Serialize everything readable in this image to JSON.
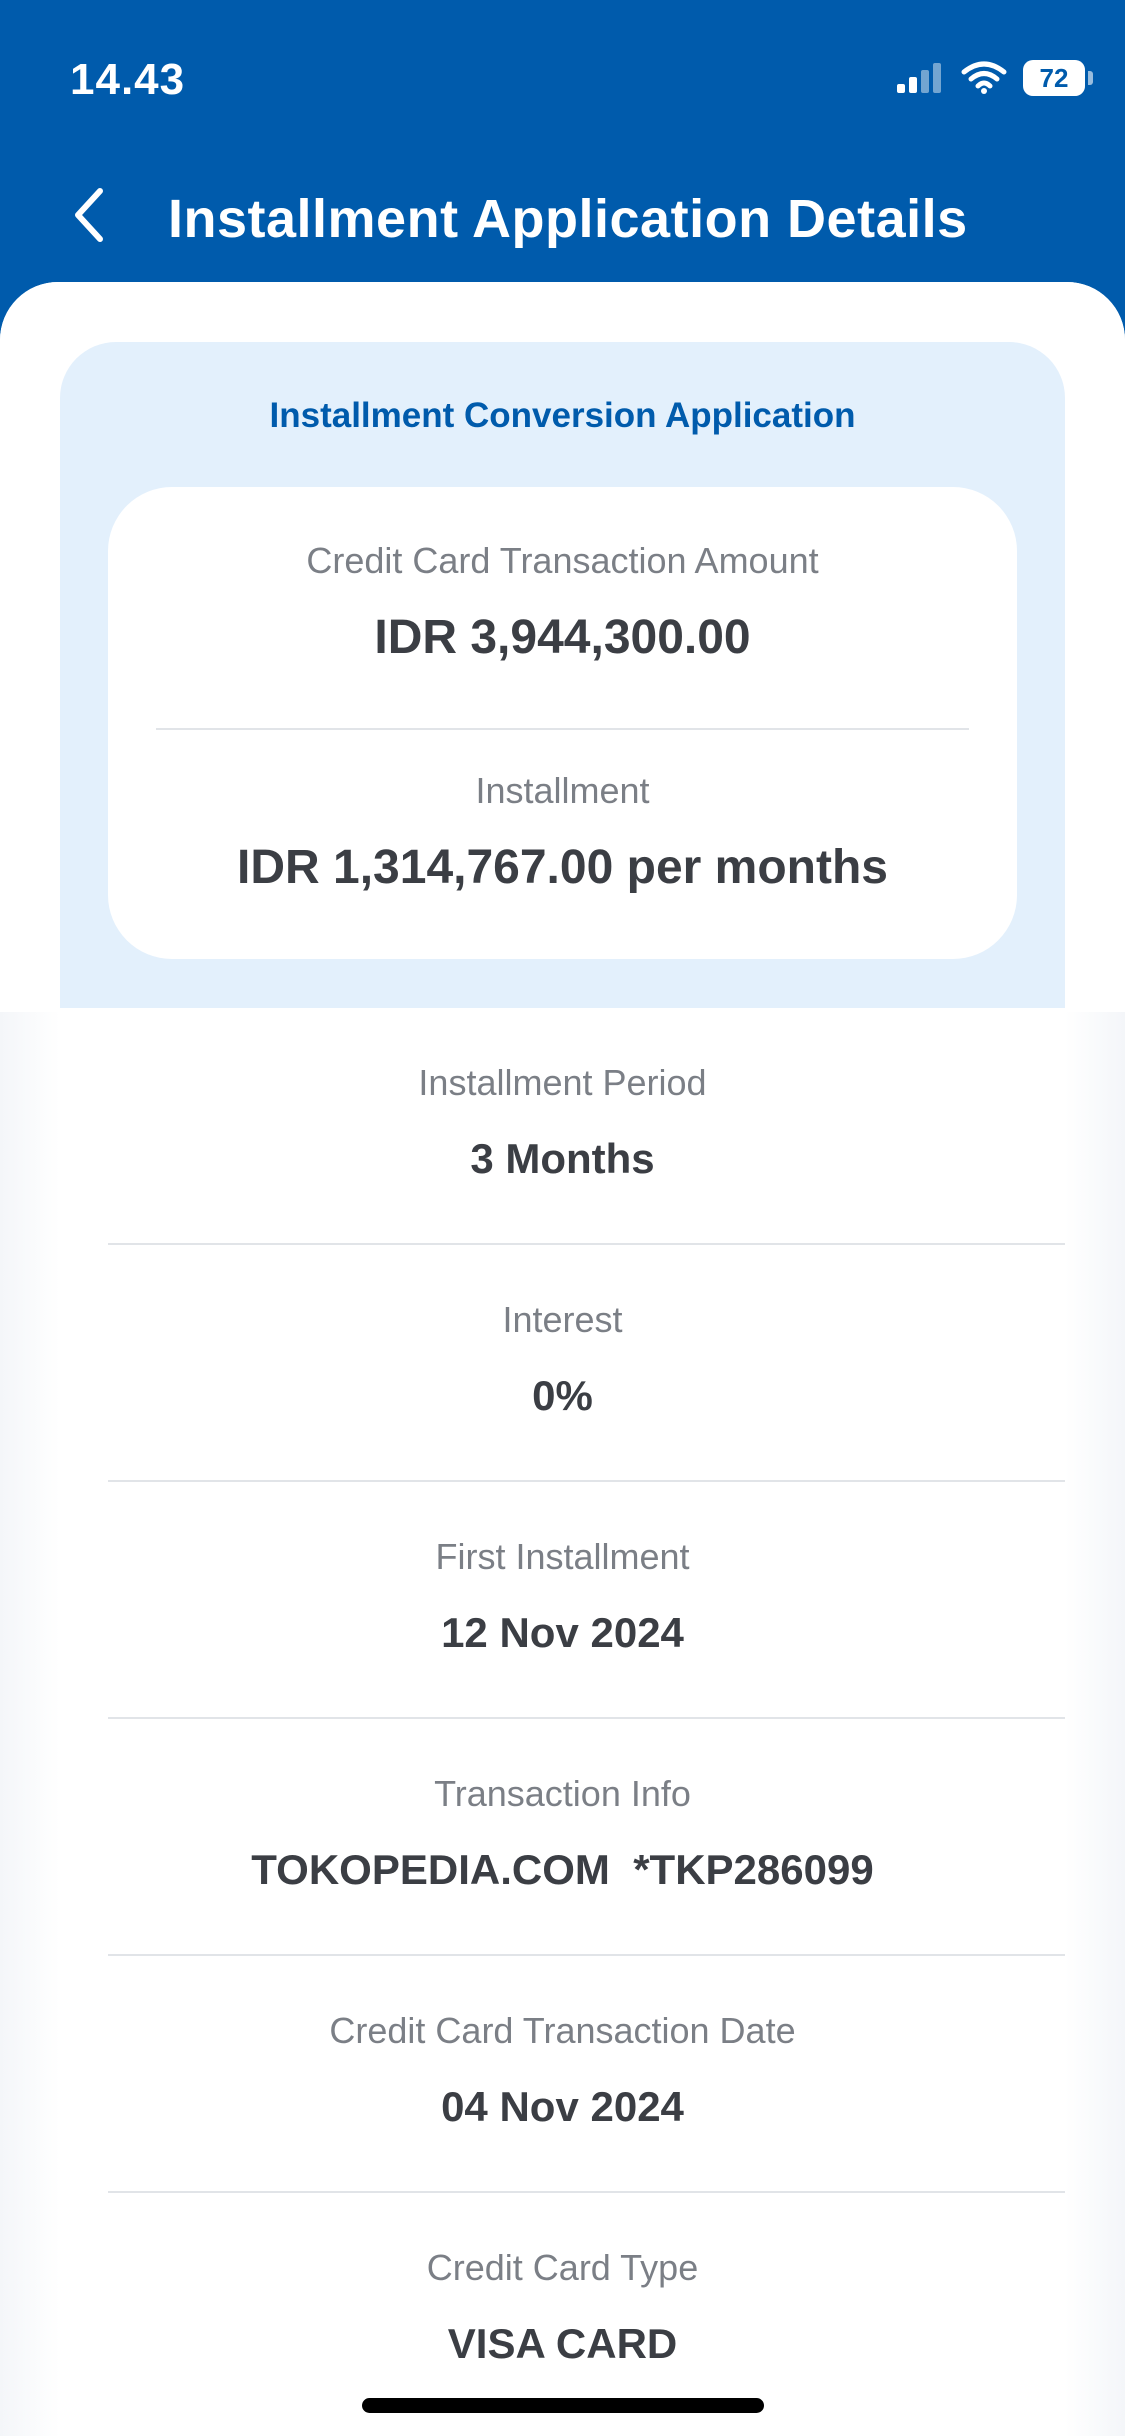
{
  "status_bar": {
    "time": "14.43",
    "battery": "72"
  },
  "header": {
    "title": "Installment Application Details"
  },
  "summary": {
    "section_title": "Installment Conversion Application",
    "transaction_amount_label": "Credit Card Transaction Amount",
    "transaction_amount_value": "IDR 3,944,300.00",
    "installment_label": "Installment",
    "installment_value": "IDR 1,314,767.00 per months"
  },
  "details": [
    {
      "label": "Installment Period",
      "value": "3 Months"
    },
    {
      "label": "Interest",
      "value": "0%"
    },
    {
      "label": "First Installment",
      "value": "12 Nov 2024"
    },
    {
      "label": "Transaction Info",
      "value": "TOKOPEDIA.COM  *TKP286099"
    },
    {
      "label": "Credit Card Transaction Date",
      "value": "04 Nov 2024"
    },
    {
      "label": "Credit Card Type",
      "value": "VISA CARD"
    }
  ],
  "colors": {
    "primary": "#005BAC",
    "card_bg": "#E3F0FC",
    "label": "#7B7F86",
    "value": "#3B3E44"
  },
  "icons": {
    "back": "chevron-left-icon",
    "signal": "cellular-signal-icon",
    "wifi": "wifi-icon",
    "battery": "battery-icon"
  }
}
